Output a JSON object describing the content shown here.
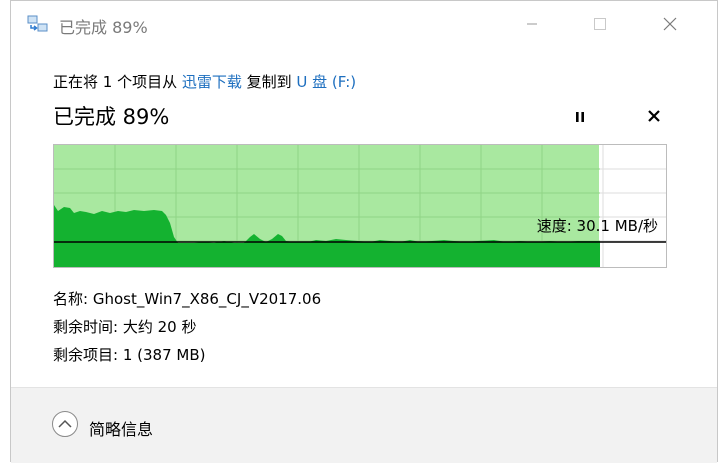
{
  "window": {
    "title": "已完成 89%"
  },
  "copy": {
    "prefix": "正在将 1 个项目从 ",
    "source": "迅雷下载",
    "middle": " 复制到 ",
    "destination": "U 盘 (F:)"
  },
  "status": {
    "headline": "已完成 89%",
    "progress_percent": 89
  },
  "graph": {
    "speed_label": "速度: 30.1 MB/秒"
  },
  "details": {
    "name_label": "名称:",
    "name_value": "Ghost_Win7_X86_CJ_V2017.06",
    "time_label": "剩余时间:",
    "time_value": "大约 20 秒",
    "items_label": "剩余项目:",
    "items_value": "1 (387 MB)"
  },
  "footer": {
    "toggle_label": "简略信息"
  },
  "colors": {
    "progress_fill": "#a9e8a0",
    "speed_fill": "#14b230",
    "link": "#1e6fbf"
  },
  "icons": {
    "app": "copy-arrow-icon",
    "minimize": "minimize-icon",
    "maximize": "maximize-icon",
    "close": "close-icon",
    "pause": "pause-icon",
    "cancel": "cancel-icon",
    "toggle": "chevron-up-icon"
  }
}
